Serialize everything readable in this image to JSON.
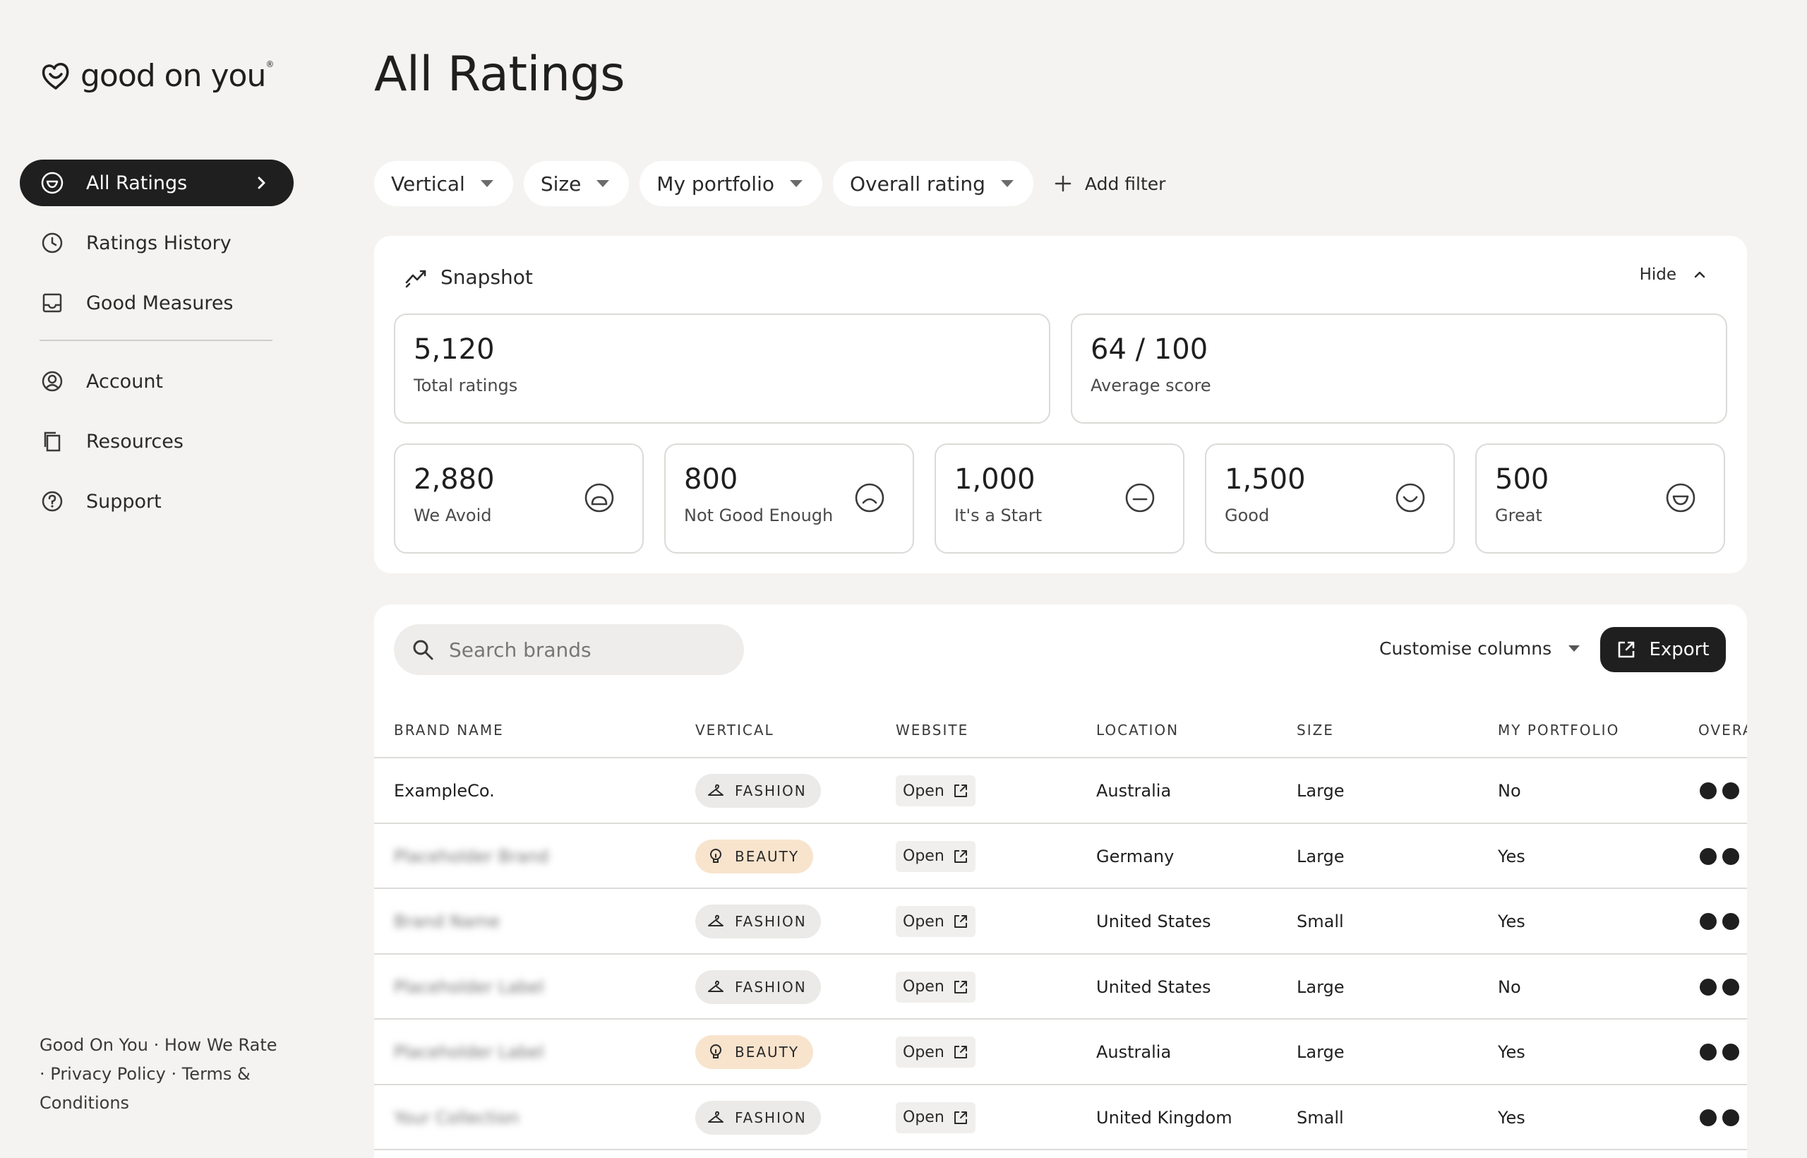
{
  "brand": {
    "logo_text": "good on you",
    "logo_mark": "®"
  },
  "sidebar": {
    "items": [
      {
        "label": "All Ratings",
        "icon": "smile-face-icon",
        "active": true
      },
      {
        "label": "Ratings History",
        "icon": "clock-icon"
      },
      {
        "label": "Good Measures",
        "icon": "inbox-tray-icon"
      },
      {
        "label": "Account",
        "icon": "user-circle-icon"
      },
      {
        "label": "Resources",
        "icon": "copy-files-icon"
      },
      {
        "label": "Support",
        "icon": "help-circle-icon"
      }
    ],
    "footer": {
      "good_on_you": "Good On You",
      "how_we_rate": "How We Rate",
      "privacy_policy": "Privacy Policy",
      "terms": "Terms & Conditions",
      "separator": " · "
    }
  },
  "header": {
    "title": "All Ratings"
  },
  "filters": {
    "chips": [
      "Vertical",
      "Size",
      "My portfolio",
      "Overall rating"
    ],
    "add_filter": "Add filter"
  },
  "snapshot": {
    "title": "Snapshot",
    "hide_label": "Hide",
    "total": {
      "value": "5,120",
      "label": "Total ratings"
    },
    "average": {
      "value": "64 / 100",
      "label": "Average score"
    },
    "categories": [
      {
        "value": "2,880",
        "label": "We Avoid",
        "icon": "face-very-sad-icon"
      },
      {
        "value": "800",
        "label": "Not Good Enough",
        "icon": "face-sad-icon"
      },
      {
        "value": "1,000",
        "label": "It's a Start",
        "icon": "face-neutral-icon"
      },
      {
        "value": "1,500",
        "label": "Good",
        "icon": "face-smile-icon"
      },
      {
        "value": "500",
        "label": "Great",
        "icon": "face-grin-icon"
      }
    ]
  },
  "table": {
    "search_placeholder": "Search brands",
    "customise_columns": "Customise columns",
    "export_label": "Export",
    "columns": [
      "BRAND NAME",
      "VERTICAL",
      "WEBSITE",
      "LOCATION",
      "SIZE",
      "MY PORTFOLIO",
      "OVERA"
    ],
    "rows": [
      {
        "brand": "ExampleCo.",
        "vertical": "FASHION",
        "website": "Open",
        "location": "Australia",
        "size": "Large",
        "portfolio": "No",
        "blurred": false
      },
      {
        "brand": "Placeholder Brand",
        "vertical": "BEAUTY",
        "website": "Open",
        "location": "Germany",
        "size": "Large",
        "portfolio": "Yes",
        "blurred": true
      },
      {
        "brand": "Brand Name",
        "vertical": "FASHION",
        "website": "Open",
        "location": "United States",
        "size": "Small",
        "portfolio": "Yes",
        "blurred": true
      },
      {
        "brand": "Placeholder Label",
        "vertical": "FASHION",
        "website": "Open",
        "location": "United States",
        "size": "Large",
        "portfolio": "No",
        "blurred": true
      },
      {
        "brand": "Placeholder Label",
        "vertical": "BEAUTY",
        "website": "Open",
        "location": "Australia",
        "size": "Large",
        "portfolio": "Yes",
        "blurred": true
      },
      {
        "brand": "Your Collection",
        "vertical": "FASHION",
        "website": "Open",
        "location": "United Kingdom",
        "size": "Small",
        "portfolio": "Yes",
        "blurred": true
      }
    ]
  }
}
